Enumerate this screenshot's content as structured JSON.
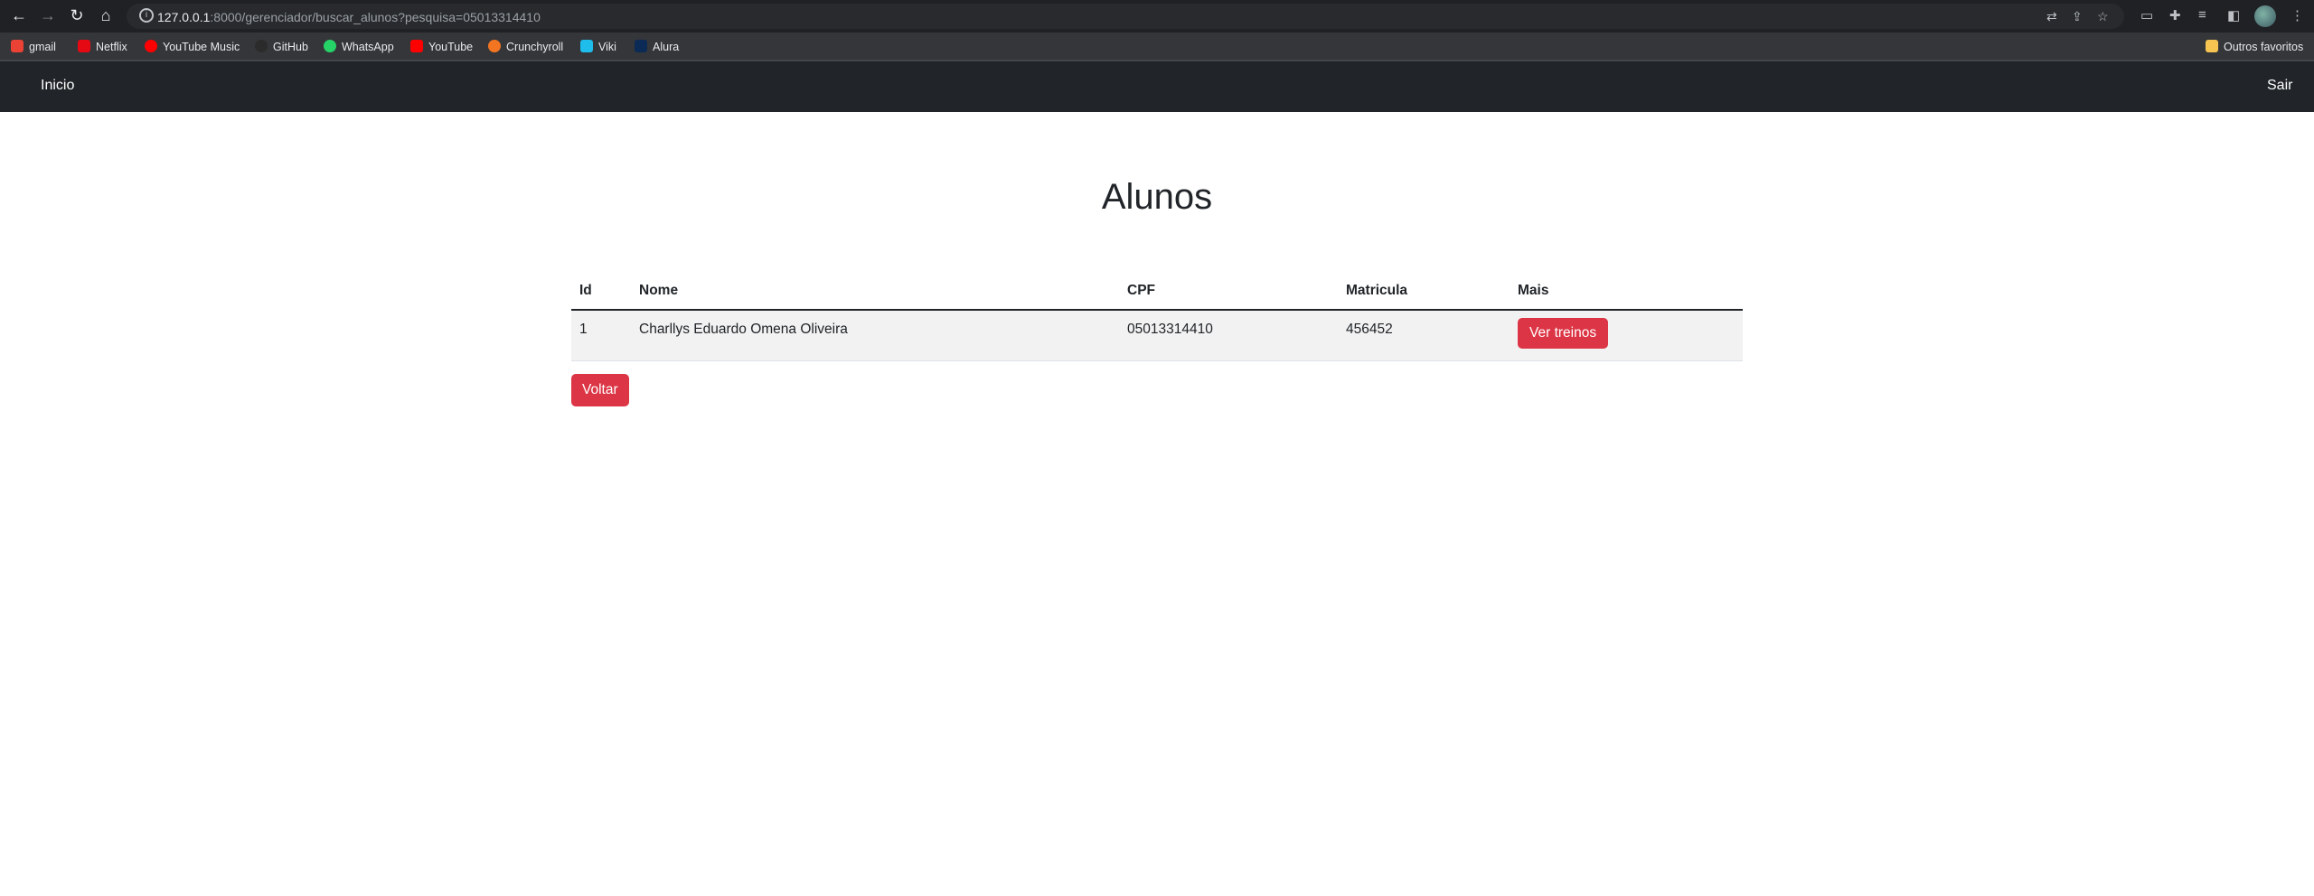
{
  "browser": {
    "url_host": "127.0.0.1",
    "url_rest": ":8000/gerenciador/buscar_alunos?pesquisa=05013314410",
    "bookmarks": [
      {
        "label": "gmail",
        "icon": "gmail-icon",
        "color": "#ea4335"
      },
      {
        "label": "Netflix",
        "icon": "netflix-icon",
        "color": "#e50914"
      },
      {
        "label": "YouTube Music",
        "icon": "youtube-music-icon",
        "color": "#ff0000"
      },
      {
        "label": "GitHub",
        "icon": "github-icon",
        "color": "#24292e"
      },
      {
        "label": "WhatsApp",
        "icon": "whatsapp-icon",
        "color": "#25d366"
      },
      {
        "label": "YouTube",
        "icon": "youtube-icon",
        "color": "#ff0000"
      },
      {
        "label": "Crunchyroll",
        "icon": "crunchyroll-icon",
        "color": "#f47521"
      },
      {
        "label": "Viki",
        "icon": "viki-icon",
        "color": "#1ebdeb"
      },
      {
        "label": "Alura",
        "icon": "alura-icon",
        "color": "#051933"
      }
    ],
    "other_bookmarks": "Outros favoritos"
  },
  "navbar": {
    "home_label": "Inicio",
    "logout_label": "Sair"
  },
  "page": {
    "title": "Alunos",
    "table": {
      "headers": [
        "Id",
        "Nome",
        "CPF",
        "Matricula",
        "Mais"
      ],
      "rows": [
        {
          "id": "1",
          "nome": "Charllys Eduardo Omena Oliveira",
          "cpf": "05013314410",
          "matricula": "456452",
          "action_label": "Ver treinos"
        }
      ]
    },
    "back_label": "Voltar"
  },
  "colors": {
    "navbar_bg": "#212529",
    "button_danger": "#dc3545",
    "row_bg": "#f2f2f2"
  }
}
